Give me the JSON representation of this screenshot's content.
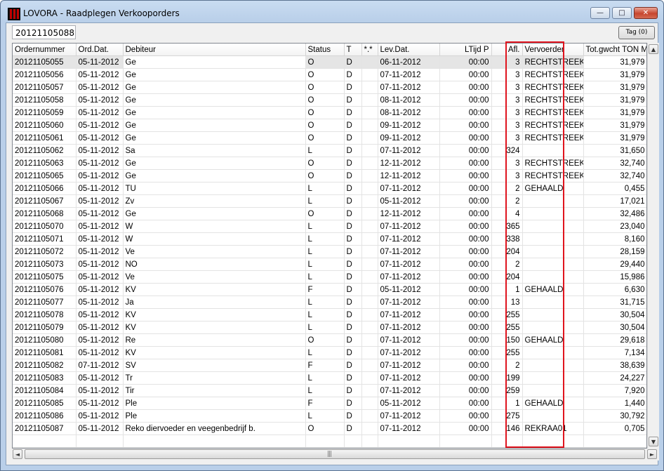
{
  "window": {
    "title": "LOVORA - Raadplegen Verkooporders",
    "minimize_glyph": "—",
    "maximize_glyph": "□",
    "close_glyph": "✕"
  },
  "search": {
    "value": "20121105088"
  },
  "toolbar": {
    "tag_label": "Tag (0)"
  },
  "table": {
    "columns": [
      "Ordernummer",
      "Ord.Dat.",
      "Debiteur",
      "Status",
      "T",
      "*.*",
      "Lev.Dat.",
      "LTijd P",
      "Afl.",
      "Vervoerder",
      "Tot.gwcht TON M"
    ],
    "rows": [
      [
        "20121105055",
        "05-11-2012",
        "Ge",
        "O",
        "D",
        "",
        "06-11-2012",
        "00:00",
        "3",
        "RECHTSTREEK",
        "31,979"
      ],
      [
        "20121105056",
        "05-11-2012",
        "Ge",
        "O",
        "D",
        "",
        "07-11-2012",
        "00:00",
        "3",
        "RECHTSTREEK",
        "31,979"
      ],
      [
        "20121105057",
        "05-11-2012",
        "Ge",
        "O",
        "D",
        "",
        "07-11-2012",
        "00:00",
        "3",
        "RECHTSTREEK",
        "31,979"
      ],
      [
        "20121105058",
        "05-11-2012",
        "Ge",
        "O",
        "D",
        "",
        "08-11-2012",
        "00:00",
        "3",
        "RECHTSTREEK",
        "31,979"
      ],
      [
        "20121105059",
        "05-11-2012",
        "Ge",
        "O",
        "D",
        "",
        "08-11-2012",
        "00:00",
        "3",
        "RECHTSTREEK",
        "31,979"
      ],
      [
        "20121105060",
        "05-11-2012",
        "Ge",
        "O",
        "D",
        "",
        "09-11-2012",
        "00:00",
        "3",
        "RECHTSTREEK",
        "31,979"
      ],
      [
        "20121105061",
        "05-11-2012",
        "Ge",
        "O",
        "D",
        "",
        "09-11-2012",
        "00:00",
        "3",
        "RECHTSTREEK",
        "31,979"
      ],
      [
        "20121105062",
        "05-11-2012",
        "Sa",
        "L",
        "D",
        "",
        "07-11-2012",
        "00:00",
        "324",
        "",
        "31,650"
      ],
      [
        "20121105063",
        "05-11-2012",
        "Ge",
        "O",
        "D",
        "",
        "12-11-2012",
        "00:00",
        "3",
        "RECHTSTREEK",
        "32,740"
      ],
      [
        "20121105065",
        "05-11-2012",
        "Ge",
        "O",
        "D",
        "",
        "12-11-2012",
        "00:00",
        "3",
        "RECHTSTREEK",
        "32,740"
      ],
      [
        "20121105066",
        "05-11-2012",
        "TU",
        "L",
        "D",
        "",
        "07-11-2012",
        "00:00",
        "2",
        "GEHAALD",
        "0,455"
      ],
      [
        "20121105067",
        "05-11-2012",
        "Zv",
        "L",
        "D",
        "",
        "05-11-2012",
        "00:00",
        "2",
        "",
        "17,021"
      ],
      [
        "20121105068",
        "05-11-2012",
        "Ge",
        "O",
        "D",
        "",
        "12-11-2012",
        "00:00",
        "4",
        "",
        "32,486"
      ],
      [
        "20121105070",
        "05-11-2012",
        "W",
        "L",
        "D",
        "",
        "07-11-2012",
        "00:00",
        "365",
        "",
        "23,040"
      ],
      [
        "20121105071",
        "05-11-2012",
        "W",
        "L",
        "D",
        "",
        "07-11-2012",
        "00:00",
        "338",
        "",
        "8,160"
      ],
      [
        "20121105072",
        "05-11-2012",
        "Ve",
        "L",
        "D",
        "",
        "07-11-2012",
        "00:00",
        "204",
        "",
        "28,159"
      ],
      [
        "20121105073",
        "05-11-2012",
        "NO",
        "L",
        "D",
        "",
        "07-11-2012",
        "00:00",
        "2",
        "",
        "29,440"
      ],
      [
        "20121105075",
        "05-11-2012",
        "Ve",
        "L",
        "D",
        "",
        "07-11-2012",
        "00:00",
        "204",
        "",
        "15,986"
      ],
      [
        "20121105076",
        "05-11-2012",
        "KV",
        "F",
        "D",
        "",
        "05-11-2012",
        "00:00",
        "1",
        "GEHAALD",
        "6,630"
      ],
      [
        "20121105077",
        "05-11-2012",
        "Ja",
        "L",
        "D",
        "",
        "07-11-2012",
        "00:00",
        "13",
        "",
        "31,715"
      ],
      [
        "20121105078",
        "05-11-2012",
        "KV",
        "L",
        "D",
        "",
        "07-11-2012",
        "00:00",
        "255",
        "",
        "30,504"
      ],
      [
        "20121105079",
        "05-11-2012",
        "KV",
        "L",
        "D",
        "",
        "07-11-2012",
        "00:00",
        "255",
        "",
        "30,504"
      ],
      [
        "20121105080",
        "05-11-2012",
        "Re",
        "O",
        "D",
        "",
        "07-11-2012",
        "00:00",
        "150",
        "GEHAALD",
        "29,618"
      ],
      [
        "20121105081",
        "05-11-2012",
        "KV",
        "L",
        "D",
        "",
        "07-11-2012",
        "00:00",
        "255",
        "",
        "7,134"
      ],
      [
        "20121105082",
        "07-11-2012",
        "SV",
        "F",
        "D",
        "",
        "07-11-2012",
        "00:00",
        "2",
        "",
        "38,639"
      ],
      [
        "20121105083",
        "05-11-2012",
        "Tr",
        "L",
        "D",
        "",
        "07-11-2012",
        "00:00",
        "199",
        "",
        "24,227"
      ],
      [
        "20121105084",
        "05-11-2012",
        "Tir",
        "L",
        "D",
        "",
        "07-11-2012",
        "00:00",
        "259",
        "",
        "7,920"
      ],
      [
        "20121105085",
        "05-11-2012",
        "Ple",
        "F",
        "D",
        "",
        "05-11-2012",
        "00:00",
        "1",
        "GEHAALD",
        "1,440"
      ],
      [
        "20121105086",
        "05-11-2012",
        "Ple",
        "L",
        "D",
        "",
        "07-11-2012",
        "00:00",
        "275",
        "",
        "30,792"
      ],
      [
        "20121105087",
        "05-11-2012",
        "Reko diervoeder en veegenbedrijf b.",
        "O",
        "D",
        "",
        "07-11-2012",
        "00:00",
        "146",
        "REKRAA01",
        "0,705"
      ]
    ]
  },
  "scroll": {
    "up_glyph": "▲",
    "down_glyph": "▼",
    "left_glyph": "◄",
    "right_glyph": "►",
    "grip_glyph": "|||"
  },
  "annotation": {
    "color": "#e0141e"
  }
}
